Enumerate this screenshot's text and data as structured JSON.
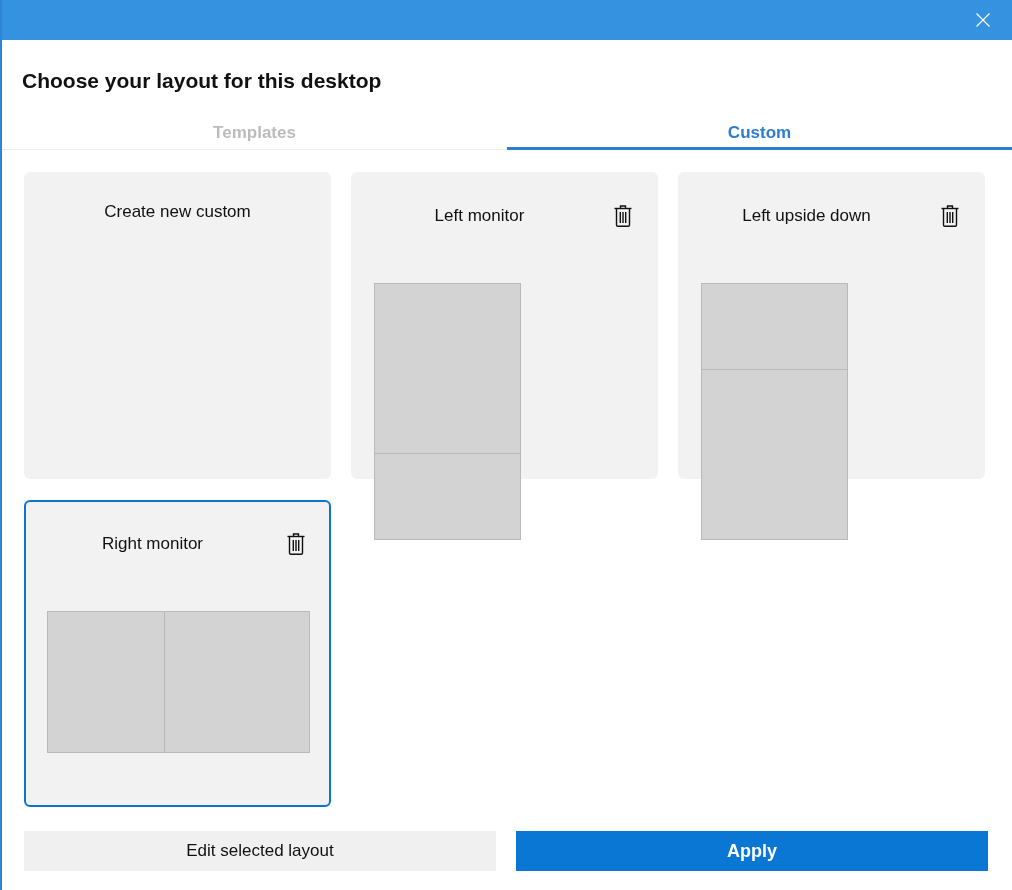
{
  "title": "Choose your layout for this desktop",
  "tabs": [
    {
      "label": "Templates",
      "selected": false
    },
    {
      "label": "Custom",
      "selected": true
    }
  ],
  "cards": [
    {
      "kind": "create",
      "title": "Create new custom",
      "selected": false
    },
    {
      "kind": "layout",
      "title": "Left monitor",
      "selected": false,
      "preview": {
        "kind": "portrait",
        "zones": [
          {
            "kind": "large"
          },
          {
            "kind": "small"
          }
        ]
      }
    },
    {
      "kind": "layout",
      "title": "Left upside down",
      "selected": false,
      "preview": {
        "kind": "portrait",
        "zones": [
          {
            "kind": "small"
          },
          {
            "kind": "large"
          }
        ]
      }
    },
    {
      "kind": "layout",
      "title": "Right monitor",
      "selected": true,
      "preview": {
        "kind": "landscape",
        "zones": [
          {
            "kind": "small"
          },
          {
            "kind": "medium"
          }
        ]
      }
    }
  ],
  "buttons": [
    {
      "label": "Edit selected layout",
      "kind": "secondary"
    },
    {
      "label": "Apply",
      "kind": "primary"
    }
  ]
}
